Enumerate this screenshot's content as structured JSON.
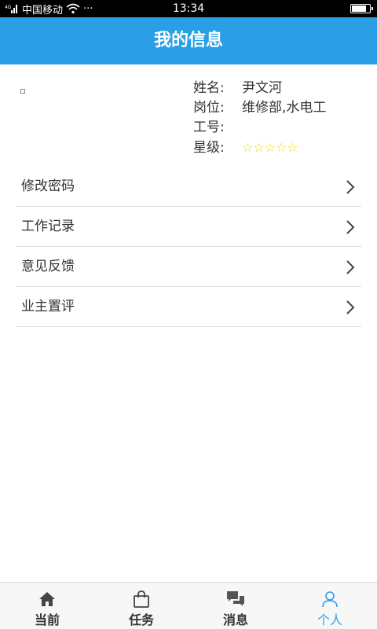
{
  "status_bar": {
    "carrier": "中国移动",
    "more": "···",
    "time": "13:34",
    "battery_level": 0.85
  },
  "header": {
    "title": "我的信息"
  },
  "profile": {
    "rows": [
      {
        "label": "姓名:",
        "value": "尹文河"
      },
      {
        "label": "岗位:",
        "value": "维修部,水电工"
      },
      {
        "label": "工号:",
        "value": ""
      },
      {
        "label": "星级:",
        "value": "☆☆☆☆☆"
      }
    ],
    "star_rating": 0,
    "star_max": 5,
    "star_color": "#e6df1a"
  },
  "menu": {
    "items": [
      {
        "label": "修改密码"
      },
      {
        "label": "工作记录"
      },
      {
        "label": "意见反馈"
      },
      {
        "label": "业主置评"
      }
    ]
  },
  "tabs": [
    {
      "label": "当前",
      "icon": "home-icon"
    },
    {
      "label": "任务",
      "icon": "bag-icon"
    },
    {
      "label": "消息",
      "icon": "chat-icon"
    },
    {
      "label": "个人",
      "icon": "person-icon",
      "active": true
    }
  ],
  "colors": {
    "accent": "#2a9fe6",
    "text": "#333333",
    "divider": "#dedede"
  }
}
